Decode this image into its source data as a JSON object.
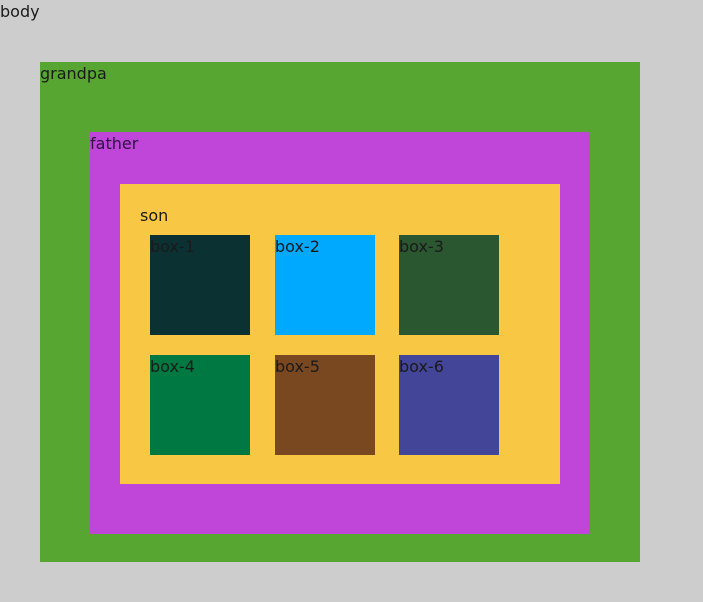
{
  "body": {
    "label": "body",
    "color": "#cdcdcd"
  },
  "grandpa": {
    "label": "grandpa",
    "color": "#56a631"
  },
  "father": {
    "label": "father",
    "color": "#c046da"
  },
  "son": {
    "label": "son",
    "color": "#f8c844"
  },
  "boxes": [
    {
      "label": "box-1",
      "color": "#0b3132"
    },
    {
      "label": "box-2",
      "color": "#00a8fe"
    },
    {
      "label": "box-3",
      "color": "#2a5630"
    },
    {
      "label": "box-4",
      "color": "#007841"
    },
    {
      "label": "box-5",
      "color": "#7a4820"
    },
    {
      "label": "box-6",
      "color": "#434599"
    }
  ]
}
